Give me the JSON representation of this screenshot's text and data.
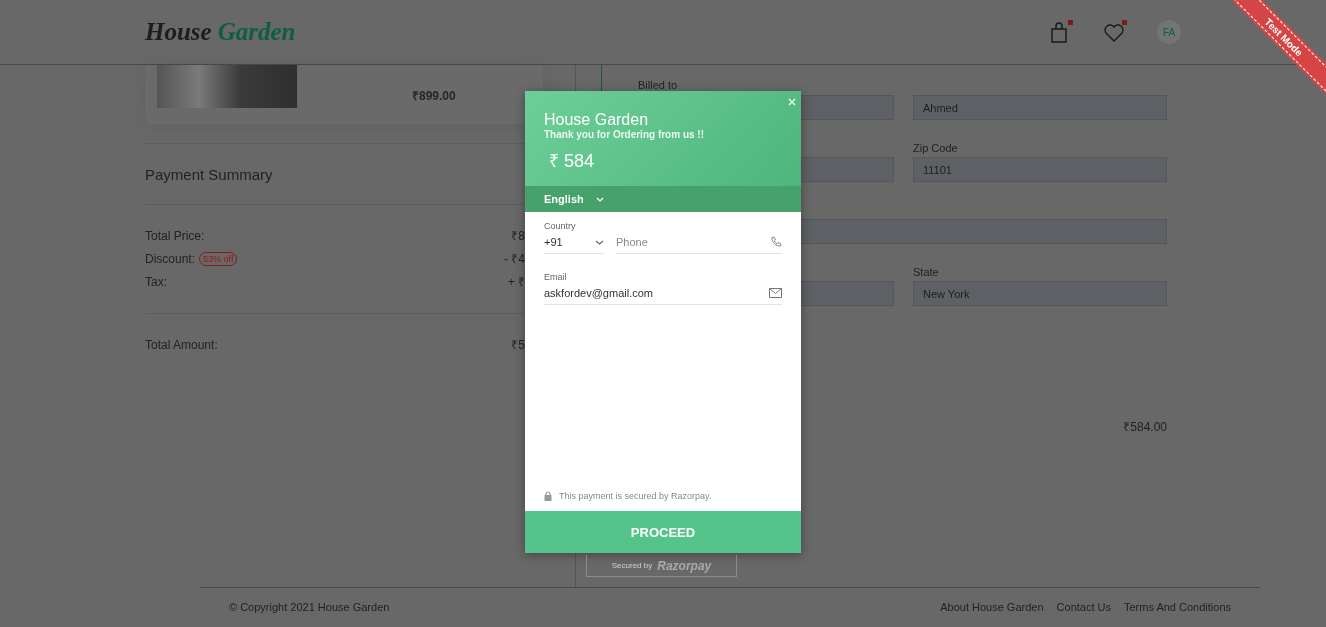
{
  "header": {
    "logo_first": "House",
    "logo_second": "Garden",
    "cart_badge": true,
    "wishlist_badge": true,
    "avatar": "FA"
  },
  "ribbon": "Test Mode",
  "cart_item": {
    "price": "₹899.00"
  },
  "summary": {
    "title": "Payment Summary",
    "rows": [
      {
        "label": "Total Price:",
        "value": "₹8"
      },
      {
        "label": "Discount:",
        "badge": "53% off",
        "value": "- ₹4"
      },
      {
        "label": "Tax:",
        "value": "+ ₹"
      }
    ],
    "total_label": "Total Amount:",
    "total_value": "₹5"
  },
  "billing": {
    "heading": "Billed to",
    "fields": [
      {
        "kind": "half"
      },
      {
        "kind": "half",
        "value": "Ahmed"
      },
      {
        "kind": "half"
      },
      {
        "kind": "half",
        "label": "Zip Code",
        "value": "11101"
      },
      {
        "kind": "wide"
      },
      {
        "kind": "half"
      },
      {
        "kind": "half",
        "label": "State",
        "value": "New York"
      }
    ],
    "order_total": "₹584.00"
  },
  "checkout": {
    "merchant": "House Garden",
    "tagline": "Thank you for Ordering from us !!",
    "amount": "₹ 584",
    "language": "English",
    "country_label": "Country",
    "country_code": "+91",
    "phone_placeholder": "Phone",
    "email_label": "Email",
    "email": "askfordev@gmail.com",
    "secure_note": "This payment is secured by Razorpay.",
    "button": "PROCEED",
    "secured_by": "Secured by",
    "brand": "Razorpay"
  },
  "footer": {
    "copyright": "© Copyright 2021 House Garden",
    "links": [
      "About House Garden",
      "Contact Us",
      "Terms And Conditions"
    ]
  }
}
